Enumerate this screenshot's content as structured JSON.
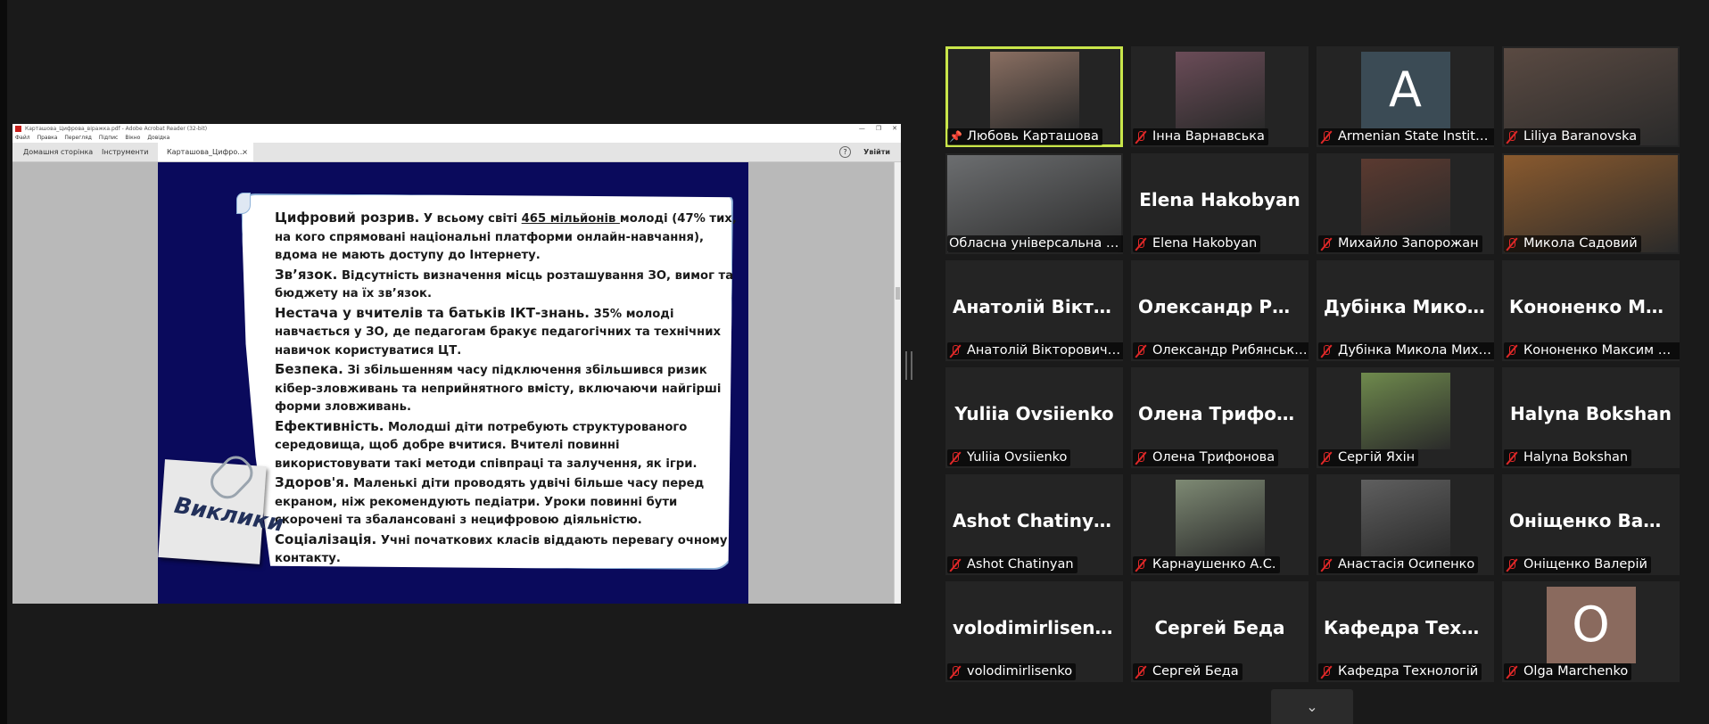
{
  "window": {
    "title": "Карташова_Цифрова_віражка.pdf - Adobe Acrobat Reader (32-bit)",
    "menu": [
      "Файл",
      "Правка",
      "Перегляд",
      "Підпис",
      "Вікно",
      "Довідка"
    ],
    "window_controls": [
      "—",
      "❐",
      "✕"
    ]
  },
  "tabs": {
    "home": "Домашня сторінка",
    "tools": "Інструменти",
    "document": "Карташова_Цифро...",
    "close": "×",
    "help": "?",
    "sign_in": "Увійти"
  },
  "slide": {
    "sticky_note": "Виклики",
    "paragraphs": [
      {
        "heading": "Цифровий розрив.",
        "pre": " У всьому світі ",
        "underlined": "465 мільйонів ",
        "body": " молоді (47% тих, на кого спрямовані національні платформи онлайн-навчання), вдома не мають доступу до Інтернету."
      },
      {
        "heading": "Зв’язок.",
        "pre": " Відсутність визначення місць розташування ЗО, вимог та бюджету на їх зв’язок.",
        "underlined": "",
        "body": ""
      },
      {
        "heading": "Нестача у вчителів та батьків ІКТ-знань.",
        "pre": " 35% молоді навчається у ЗО, де педагогам бракує педагогічних та технічних навичок користуватися ЦТ.",
        "underlined": "",
        "body": ""
      },
      {
        "heading": "Безпека.",
        "pre": " Зі збільшенням часу підключення збільшився ризик кібер-зловживань та неприйнятного вмісту, включаючи найгірші форми зловживань.",
        "underlined": "",
        "body": ""
      },
      {
        "heading": "Ефективність.",
        "pre": " Молодші діти потребують структурованого середовища, щоб добре вчитися. Вчителі повинні використовувати такі методи співпраці та залучення, як ігри.",
        "underlined": "",
        "body": ""
      },
      {
        "heading": "Здоров'я.",
        "pre": " Маленькі діти проводять удвічі більше часу перед екраном, ніж рекомендують педіатри. Уроки повинні бути скорочені та збалансовані з нецифровою діяльністю.",
        "underlined": "",
        "body": ""
      },
      {
        "heading": "Соціалізація.",
        "pre": " Учні початкових класів віддають перевагу очному контакту.",
        "underlined": "",
        "body": ""
      }
    ]
  },
  "participants": [
    {
      "name": "Любовь Карташова",
      "big": "",
      "kind": "photo",
      "color": "#8a6f62",
      "pinned": true,
      "muted": false,
      "active": true
    },
    {
      "name": "Інна Варнавська",
      "big": "",
      "kind": "photo",
      "color": "#6b4c58",
      "muted": true
    },
    {
      "name": "Armenian State Institut...",
      "big": "A",
      "kind": "avatar",
      "color": "#3b4b55",
      "muted": true
    },
    {
      "name": "Liliya Baranovska",
      "big": "",
      "kind": "fullphoto",
      "color": "#5a4a42",
      "muted": true
    },
    {
      "name": "Обласна універсальна на...",
      "big": "",
      "kind": "fullphoto",
      "color": "#6c6e70",
      "muted": false
    },
    {
      "name": "Elena Hakobyan",
      "big": "Elena Hakobyan",
      "kind": "name",
      "color": "",
      "muted": true
    },
    {
      "name": "Михайло Запорожан",
      "big": "",
      "kind": "photo",
      "color": "#5b3a30",
      "muted": true
    },
    {
      "name": "Микола Садовий",
      "big": "",
      "kind": "fullphoto",
      "color": "#8a5a2e",
      "muted": true
    },
    {
      "name": "Анатолій Вікторович ...",
      "big": "Анатолій Вікто...",
      "kind": "name",
      "color": "",
      "muted": true
    },
    {
      "name": "Олександр Рибянський",
      "big": "Олександр Риб...",
      "kind": "name",
      "color": "",
      "muted": true
    },
    {
      "name": "Дубінка Микола Миха...",
      "big": "Дубінка Микол...",
      "kind": "name",
      "color": "",
      "muted": true
    },
    {
      "name": "Кононенко Максим М...",
      "big": "Кононенко Ма...",
      "kind": "name",
      "color": "",
      "muted": true
    },
    {
      "name": "Yuliia Ovsiienko",
      "big": "Yuliia Ovsiienko",
      "kind": "name",
      "color": "",
      "muted": true
    },
    {
      "name": "Олена Трифонова",
      "big": "Олена Трифон...",
      "kind": "name",
      "color": "",
      "muted": true
    },
    {
      "name": "Сергій Яхін",
      "big": "",
      "kind": "photo",
      "color": "#6f8a4d",
      "muted": true
    },
    {
      "name": "Halyna Bokshan",
      "big": "Halyna Bokshan",
      "kind": "name",
      "color": "",
      "muted": true
    },
    {
      "name": "Ashot Chatinyan",
      "big": "Ashot Chatinyan",
      "kind": "name",
      "color": "",
      "muted": true
    },
    {
      "name": "Карнаушенко А.С.",
      "big": "",
      "kind": "photo",
      "color": "#7e8a74",
      "muted": true
    },
    {
      "name": "Анастасія Осипенко",
      "big": "",
      "kind": "photo",
      "color": "#5f5f5f",
      "muted": true
    },
    {
      "name": "Оніщенко Валерій",
      "big": "Оніщенко Вале...",
      "kind": "name",
      "color": "",
      "muted": true
    },
    {
      "name": "volodimirlisenko",
      "big": "volodimirlisenko",
      "kind": "name",
      "color": "",
      "muted": true
    },
    {
      "name": "Сергей Беда",
      "big": "Сергей Беда",
      "kind": "name",
      "color": "",
      "muted": true
    },
    {
      "name": "Кафедра Технологій",
      "big": "Кафедра Техно...",
      "kind": "name",
      "color": "",
      "muted": true
    },
    {
      "name": "Olga Marchenko",
      "big": "O",
      "kind": "avatar",
      "color": "#8a6a5e",
      "muted": true
    }
  ],
  "pager": {
    "label": "⌄"
  },
  "colors": {
    "active_speaker": "#c9e64a",
    "muted": "#e02828",
    "slide_bg": "#0a0a5c"
  }
}
